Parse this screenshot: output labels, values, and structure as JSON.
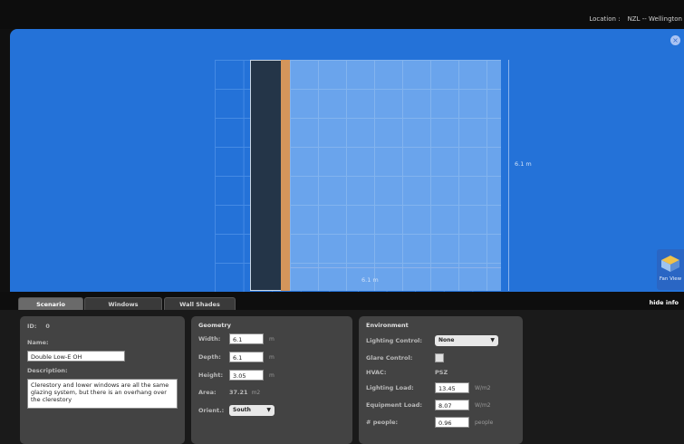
{
  "topbar": {
    "location_label": "Location :",
    "location_value": "NZL -- Wellington"
  },
  "viewport": {
    "close_icon": "close-icon",
    "depth_dim": "6.1 m",
    "width_dim": "6.1 m",
    "fan_view_label": "Fan View",
    "colors": {
      "background": "#2472d8",
      "floor": "#6aa4ec",
      "wall": "#243548",
      "overhang": "#d4955b"
    }
  },
  "tabs": [
    {
      "label": "Scenario",
      "active": true
    },
    {
      "label": "Windows",
      "active": false
    },
    {
      "label": "Wall Shades",
      "active": false
    }
  ],
  "hide_info": "hide info",
  "scenario": {
    "id_label": "ID:",
    "id_value": "0",
    "name_label": "Name:",
    "name_value": "Double Low-E OH",
    "description_label": "Description:",
    "description_value": "Clerestory and lower windows are all the same glazing system, but there is an overhang over the clerestory"
  },
  "geometry": {
    "title": "Geometry",
    "width_label": "Width:",
    "width_value": "6.1",
    "width_unit": "m",
    "depth_label": "Depth:",
    "depth_value": "6.1",
    "depth_unit": "m",
    "height_label": "Height:",
    "height_value": "3.05",
    "height_unit": "m",
    "area_label": "Area:",
    "area_value": "37.21",
    "area_unit": "m2",
    "orient_label": "Orient.:",
    "orient_value": "South"
  },
  "environment": {
    "title": "Environment",
    "lighting_control_label": "Lighting Control:",
    "lighting_control_value": "None",
    "glare_control_label": "Glare Control:",
    "hvac_label": "HVAC:",
    "hvac_value": "PSZ",
    "lighting_load_label": "Lighting Load:",
    "lighting_load_value": "13.45",
    "lighting_load_unit": "W/m2",
    "equipment_load_label": "Equipment Load:",
    "equipment_load_value": "8.07",
    "equipment_load_unit": "W/m2",
    "people_label": "# people:",
    "people_value": "0.96",
    "people_unit": "people"
  }
}
